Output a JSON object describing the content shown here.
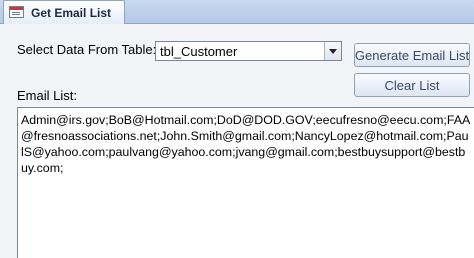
{
  "tab": {
    "title": "Get Email List",
    "icon": "form-icon"
  },
  "form": {
    "select_label": "Select Data From Table:",
    "table_combo": {
      "value": "tbl_Customer"
    },
    "email_label": "Email List:",
    "email_list": "Admin@irs.gov;BoB@Hotmail.com;DoD@DOD.GOV;eecufresno@eecu.com;FAA@fresnoassociations.net;John.Smith@gmail.com;NancyLopez@hotmail.com;PaulS@yahoo.com;paulvang@yahoo.com;jvang@gmail.com;bestbuysupport@bestbuy.com;"
  },
  "buttons": {
    "generate": "Generate Email List",
    "clear": "Clear List"
  }
}
